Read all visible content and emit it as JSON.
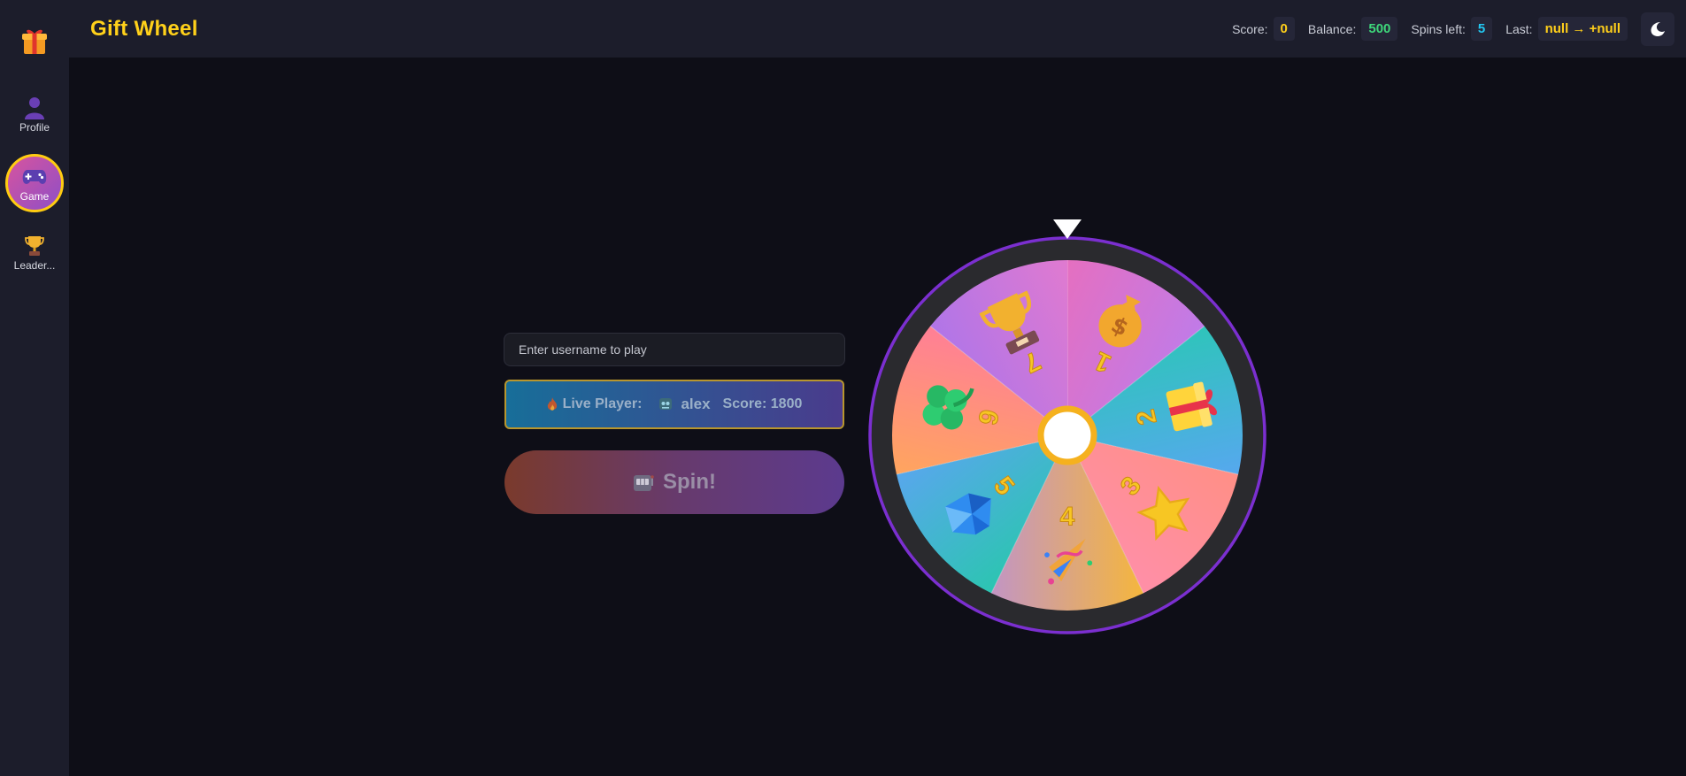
{
  "app": {
    "title": "Gift Wheel"
  },
  "sidebar": {
    "logo_icon": "gift-icon",
    "items": [
      {
        "label": "Profile",
        "icon": "user-icon",
        "active": false
      },
      {
        "label": "Game",
        "icon": "gamepad-icon",
        "active": true
      },
      {
        "label": "Leader...",
        "icon": "trophy-icon",
        "active": false
      }
    ]
  },
  "header": {
    "stats": [
      {
        "label": "Score:",
        "value": "0",
        "color": "#ffcf1a"
      },
      {
        "label": "Balance:",
        "value": "500",
        "color": "#3ed67a"
      },
      {
        "label": "Spins left:",
        "value": "5",
        "color": "#22c6f0"
      },
      {
        "label": "Last:",
        "value": "null → +null",
        "color": "#ffcf1a"
      }
    ],
    "theme_icon": "moon-icon"
  },
  "game": {
    "username_placeholder": "Enter username to play",
    "username_value": "",
    "live_label": "Live Player:",
    "live_player": "alex",
    "live_score": "Score: 1800",
    "spin_label": "Spin!",
    "spin_icon": "slot-machine-icon"
  },
  "wheel": {
    "pointer_icon": "pointer-triangle-icon",
    "rim_color": "#7b2fd0",
    "segments": [
      {
        "number": "1",
        "icon": "money-bag-icon",
        "color_a": "#e56fc0",
        "color_b": "#c07be8"
      },
      {
        "number": "2",
        "icon": "gift-icon",
        "color_a": "#2fc4bb",
        "color_b": "#56a8ee"
      },
      {
        "number": "3",
        "icon": "star-icon",
        "color_a": "#ff8f86",
        "color_b": "#ff8fa8"
      },
      {
        "number": "4",
        "icon": "party-popper-icon",
        "color_a": "#f5b63d",
        "color_b": "#c295c4"
      },
      {
        "number": "5",
        "icon": "gem-icon",
        "color_a": "#2cc5b1",
        "color_b": "#58a7ec"
      },
      {
        "number": "6",
        "icon": "clover-icon",
        "color_a": "#ffa55e",
        "color_b": "#ff7f96"
      },
      {
        "number": "7",
        "icon": "trophy-icon",
        "color_a": "#b075e8",
        "color_b": "#e07ad0"
      }
    ]
  }
}
